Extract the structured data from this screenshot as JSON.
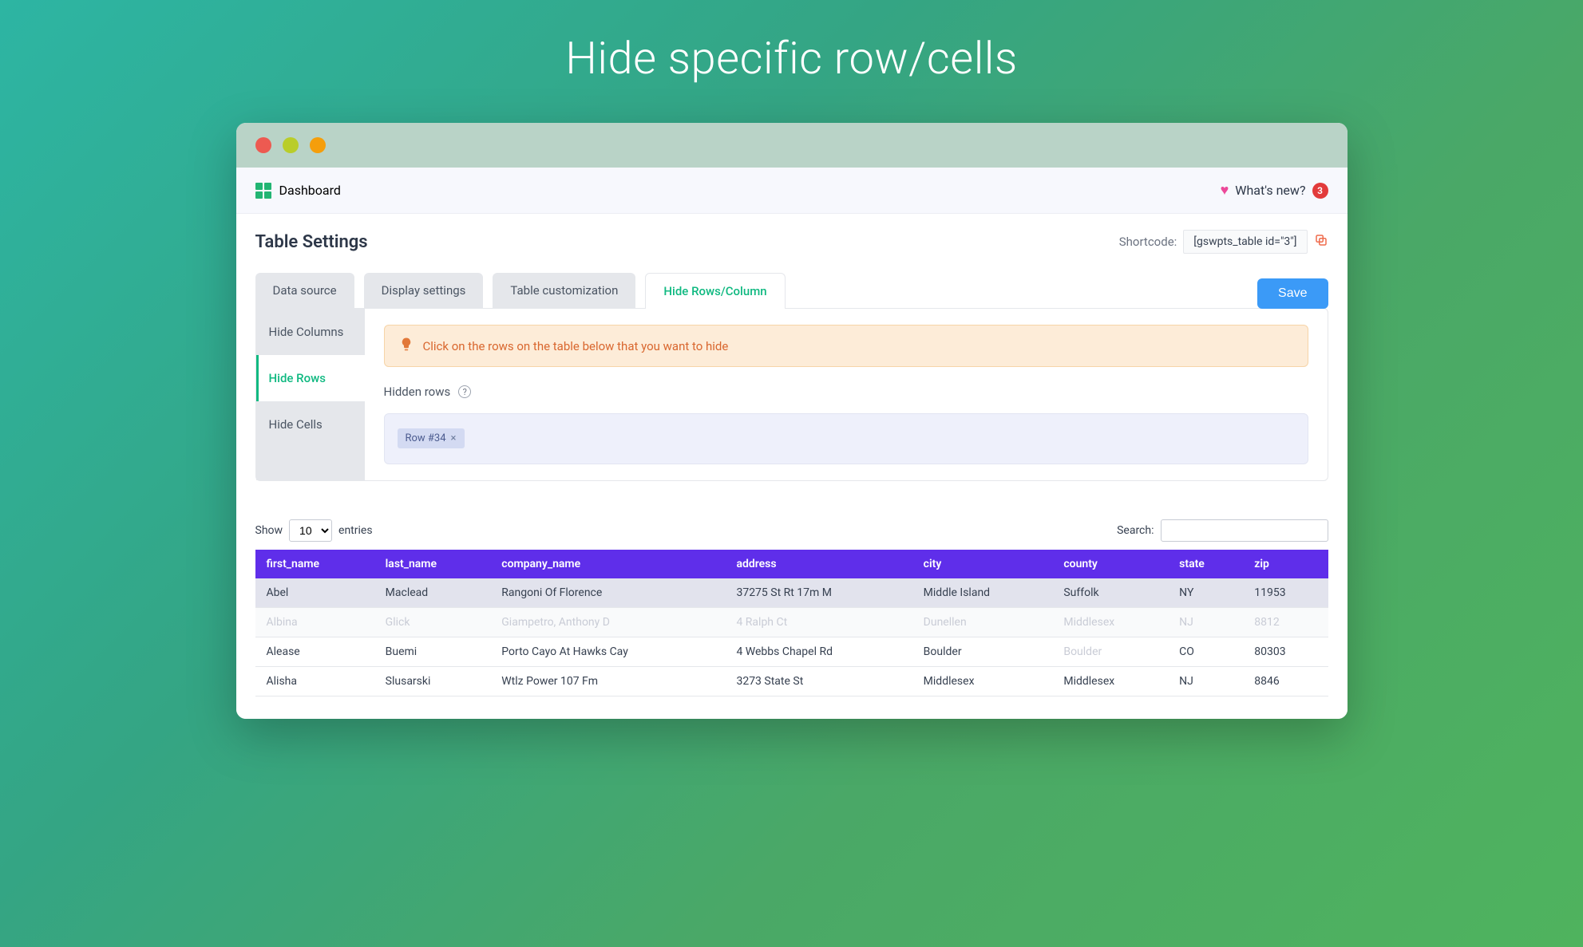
{
  "hero": {
    "title": "Hide specific row/cells"
  },
  "topbar": {
    "dashboard_label": "Dashboard",
    "whats_new_label": "What's new?",
    "whats_new_count": "3"
  },
  "page": {
    "title": "Table Settings",
    "shortcode_label": "Shortcode:",
    "shortcode_value": "[gswpts_table id=\"3\"]"
  },
  "tabs": {
    "data_source": "Data source",
    "display_settings": "Display settings",
    "table_customization": "Table customization",
    "hide_rows_column": "Hide Rows/Column"
  },
  "actions": {
    "save_label": "Save"
  },
  "sidebar": {
    "hide_columns": "Hide Columns",
    "hide_rows": "Hide Rows",
    "hide_cells": "Hide Cells"
  },
  "hint": {
    "text": "Click on the rows on the table below that you want to hide"
  },
  "hidden_rows": {
    "label": "Hidden rows",
    "chips": {
      "row34": "Row #34",
      "row34_x": "×"
    }
  },
  "table_controls": {
    "show_label": "Show",
    "entries_value": "10",
    "entries_suffix": "entries",
    "search_label": "Search:"
  },
  "table": {
    "headers": {
      "first_name": "first_name",
      "last_name": "last_name",
      "company_name": "company_name",
      "address": "address",
      "city": "city",
      "county": "county",
      "state": "state",
      "zip": "zip"
    },
    "rows": {
      "r0": {
        "first_name": "Abel",
        "last_name": "Maclead",
        "company_name": "Rangoni Of Florence",
        "address": "37275 St Rt 17m M",
        "city": "Middle Island",
        "county": "Suffolk",
        "state": "NY",
        "zip": "11953"
      },
      "r1": {
        "first_name": "Albina",
        "last_name": "Glick",
        "company_name": "Giampetro, Anthony D",
        "address": "4 Ralph Ct",
        "city": "Dunellen",
        "county": "Middlesex",
        "state": "NJ",
        "zip": "8812"
      },
      "r2": {
        "first_name": "Alease",
        "last_name": "Buemi",
        "company_name": "Porto Cayo At Hawks Cay",
        "address": "4 Webbs Chapel Rd",
        "city": "Boulder",
        "county": "Boulder",
        "state": "CO",
        "zip": "80303"
      },
      "r3": {
        "first_name": "Alisha",
        "last_name": "Slusarski",
        "company_name": "Wtlz Power 107 Fm",
        "address": "3273 State St",
        "city": "Middlesex",
        "county": "Middlesex",
        "state": "NJ",
        "zip": "8846"
      }
    }
  }
}
